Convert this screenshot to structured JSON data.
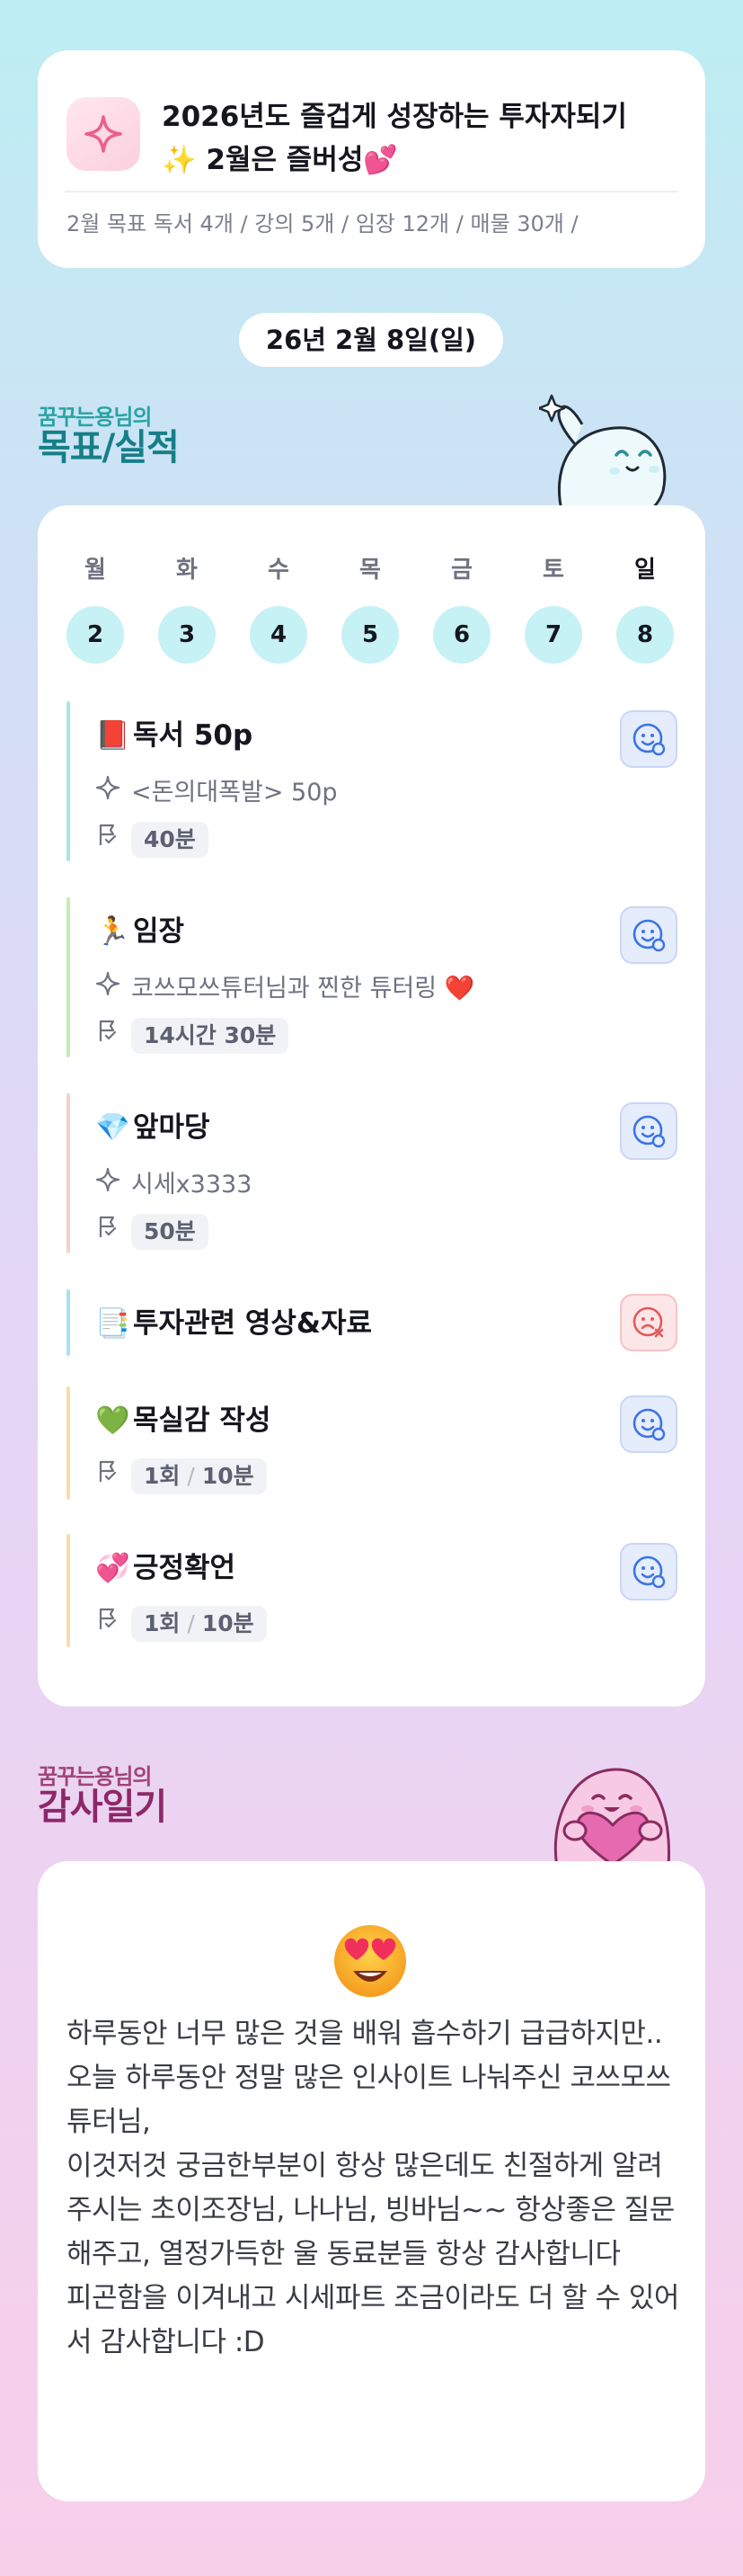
{
  "goal": {
    "title_line1": "2026년도 즐겁게 성장하는 투자자되기",
    "title_line2": "✨ 2월은 즐버성💕",
    "targets": "2월 목표  독서 4개 / 강의 5개 / 임장 12개 / 매물 30개 /"
  },
  "date": "26년 2월 8일(일)",
  "performance": {
    "subtitle": "꿈꾸는용님의",
    "title": "목표/실적",
    "week": [
      {
        "day": "월",
        "date": "2"
      },
      {
        "day": "화",
        "date": "3"
      },
      {
        "day": "수",
        "date": "4"
      },
      {
        "day": "목",
        "date": "5"
      },
      {
        "day": "금",
        "date": "6"
      },
      {
        "day": "토",
        "date": "7"
      },
      {
        "day": "일",
        "date": "8"
      }
    ],
    "tasks": [
      {
        "emoji": "📕",
        "title": "독서 50p",
        "detail": "<돈의대폭발> 50p",
        "time": "40분",
        "status": "done",
        "color": "#a8e6e6"
      },
      {
        "emoji": "🏃",
        "title": "임장",
        "detail": "코쓰모쓰튜터님과 찐한 튜터링 ❤️",
        "time": "14시간 30분",
        "status": "done",
        "color": "#c6ecb6"
      },
      {
        "emoji": "💎",
        "title": "앞마당",
        "detail": "시세x3333",
        "time": "50분",
        "status": "done",
        "color": "#f7cfcf"
      },
      {
        "emoji": "📑",
        "title": "투자관련 영상&자료",
        "status": "not-done",
        "color": "#a6e3f0"
      },
      {
        "emoji": "💚",
        "title": "목실감 작성",
        "count": "1회",
        "slash": "/",
        "time": "10분",
        "status": "done",
        "color": "#f7dcae"
      },
      {
        "emoji": "💞",
        "title": "긍정확언",
        "count": "1회",
        "slash": "/",
        "time": "10분",
        "status": "done",
        "color": "#f7dcae"
      }
    ],
    "icons": {
      "sparkle": "sparkle-outline-icon",
      "flag": "flag-icon",
      "done": "smile-check-icon",
      "not_done": "frown-x-icon"
    }
  },
  "gratitude": {
    "subtitle": "꿈꾸는용님의",
    "title": "감사일기",
    "emoji": "😍",
    "lines": [
      "하루동안 너무 많은 것을 배워 흡수하기 급급하지만..",
      "오늘 하루동안 정말 많은 인사이트 나눠주신 코쓰모쓰튜터님,",
      "이것저것 궁금한부분이 항상 많은데도 친절하게 알려주시는 초이조장님, 나나님, 빙바님~~ 항상좋은 질문해주고, 열정가득한 울 동료분들 항상 감사합니다",
      "피곤함을 이겨내고 시세파트 조금이라도 더 할 수 있어서 감사합니다 :D"
    ]
  },
  "colors": {
    "accent_teal": "#167f86",
    "accent_plum": "#8e2767",
    "day_circle": "#c6f1f5",
    "status_ok": "#3b74e6",
    "status_fail": "#e25a5a"
  }
}
